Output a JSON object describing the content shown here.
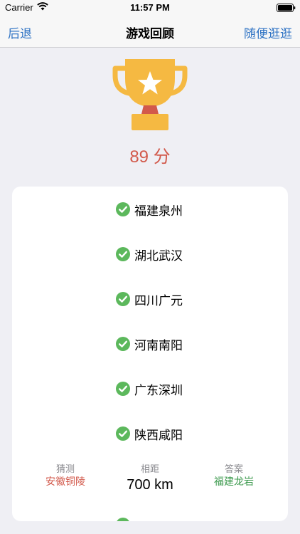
{
  "status_bar": {
    "carrier": "Carrier",
    "time": "11:57 PM"
  },
  "nav": {
    "back_label": "后退",
    "title": "游戏回顾",
    "right_label": "随便逛逛"
  },
  "score": "89 分",
  "rounds": [
    {
      "label": "福建泉州",
      "status": "correct"
    },
    {
      "label": "湖北武汉",
      "status": "correct"
    },
    {
      "label": "四川广元",
      "status": "correct"
    },
    {
      "label": "河南南阳",
      "status": "correct"
    },
    {
      "label": "广东深圳",
      "status": "correct"
    },
    {
      "label": "陕西咸阳",
      "status": "correct"
    }
  ],
  "detail": {
    "guess_caption": "猜测",
    "guess_value": "安徽铜陵",
    "distance_caption": "相距",
    "distance_value": "700 km",
    "answer_caption": "答案",
    "answer_value": "福建龙岩"
  },
  "colors": {
    "accent": "#2f73c4",
    "score": "#d2594b",
    "check": "#5cb85c",
    "answer": "#3d9a4e",
    "trophy": "#f5b942"
  }
}
